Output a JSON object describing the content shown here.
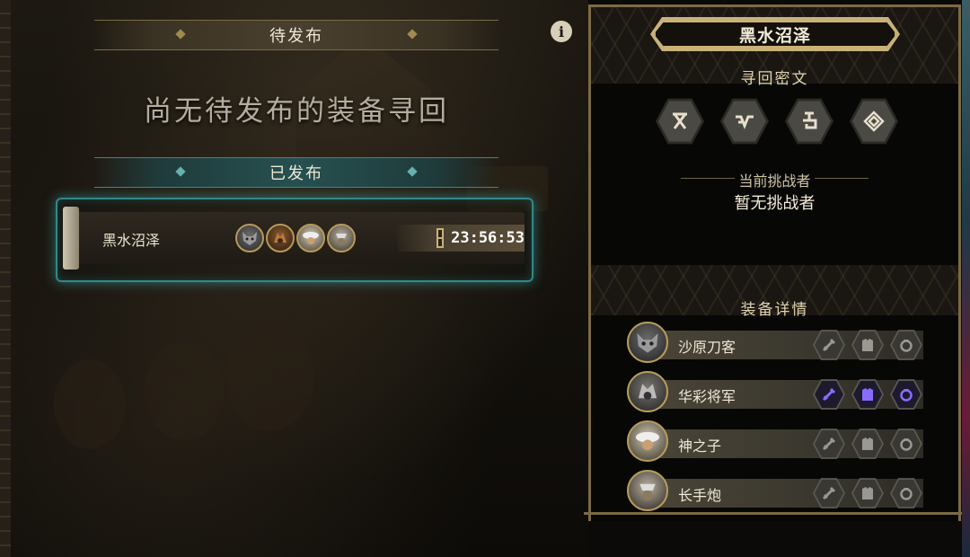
{
  "pending": {
    "title": "待发布",
    "empty_message": "尚无待发布的装备寻回"
  },
  "published": {
    "title": "已发布",
    "items": [
      {
        "name": "黑水沼泽",
        "timer": "23:56:53"
      }
    ]
  },
  "info_icon_glyph": "i",
  "region": {
    "title": "黑水沼泽",
    "runes_label": "寻回密文",
    "runes": [
      "rune-x-icon",
      "rune-zigzag-icon",
      "rune-hook-icon",
      "rune-spiral-icon"
    ],
    "challenger_label": "当前挑战者",
    "challenger_value": "暂无挑战者",
    "equipment_label": "装备详情",
    "equipment": [
      {
        "name": "沙原刀客",
        "highlighted": false
      },
      {
        "name": "华彩将军",
        "highlighted": true
      },
      {
        "name": "神之子",
        "highlighted": false
      },
      {
        "name": "长手炮",
        "highlighted": false
      }
    ]
  },
  "colors": {
    "gold": "#c9b27a",
    "teal_glow": "#2f8a8a",
    "highlight_purple": "#8a6cff"
  }
}
